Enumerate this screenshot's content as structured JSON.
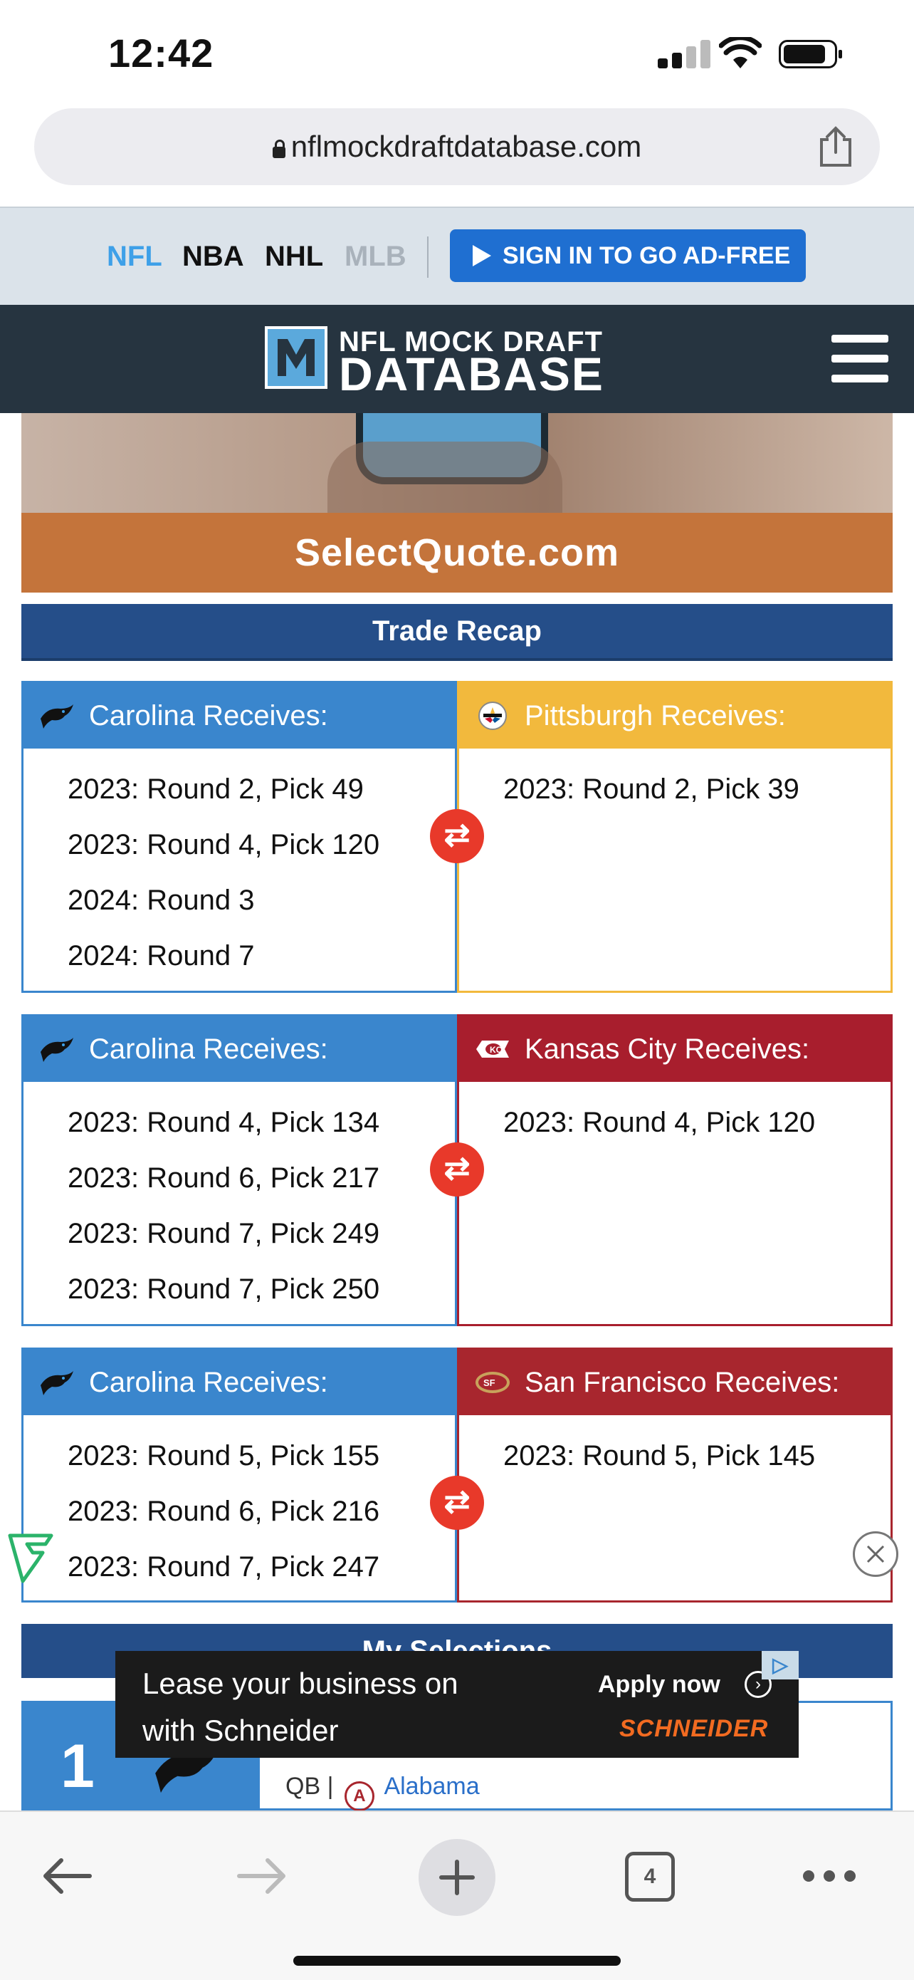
{
  "status_bar": {
    "time": "12:42"
  },
  "browser": {
    "url": "nflmockdraftdatabase.com",
    "tab_count": "4"
  },
  "league_nav": {
    "items": [
      {
        "label": "NFL",
        "color": "#3ea0e8"
      },
      {
        "label": "NBA",
        "color": "#111111"
      },
      {
        "label": "NHL",
        "color": "#111111"
      },
      {
        "label": "MLB",
        "color": "#a9b2bb"
      }
    ],
    "signin_label": "SIGN IN TO GO AD-FREE"
  },
  "site": {
    "logo_line1": "NFL MOCK DRAFT",
    "logo_line2": "DATABASE"
  },
  "ad_top": {
    "text": "SelectQuote.com"
  },
  "trade_recap": {
    "title": "Trade Recap",
    "trades": [
      {
        "left": {
          "team": "Carolina Receives:",
          "color": "#3a86cd",
          "picks": [
            "2023: Round 2, Pick 49",
            "2023: Round 4, Pick 120",
            "2024: Round 3",
            "2024: Round 7"
          ]
        },
        "right": {
          "team": "Pittsburgh Receives:",
          "color": "#f2b93d",
          "picks": [
            "2023: Round 2, Pick 39"
          ]
        }
      },
      {
        "left": {
          "team": "Carolina Receives:",
          "color": "#3a86cd",
          "picks": [
            "2023: Round 4, Pick 134",
            "2023: Round 6, Pick 217",
            "2023: Round 7, Pick 249",
            "2023: Round 7, Pick 250"
          ]
        },
        "right": {
          "team": "Kansas City Receives:",
          "color": "#a81e2d",
          "picks": [
            "2023: Round 4, Pick 120"
          ]
        }
      },
      {
        "left": {
          "team": "Carolina Receives:",
          "color": "#3a86cd",
          "picks": [
            "2023: Round 5, Pick 155",
            "2023: Round 6, Pick 216",
            "2023: Round 7, Pick 247"
          ]
        },
        "right": {
          "team": "San Francisco Receives:",
          "color": "#a8262e",
          "picks": [
            "2023: Round 5, Pick 145"
          ]
        }
      }
    ]
  },
  "my_selections": {
    "title": "My Selections",
    "pick_number": "1",
    "position": "QB |",
    "school": "Alabama"
  },
  "ad_bottom": {
    "line1": "Lease your business on",
    "line2": "with Schneider",
    "cta": "Apply now",
    "brand": "SCHNEIDER"
  }
}
